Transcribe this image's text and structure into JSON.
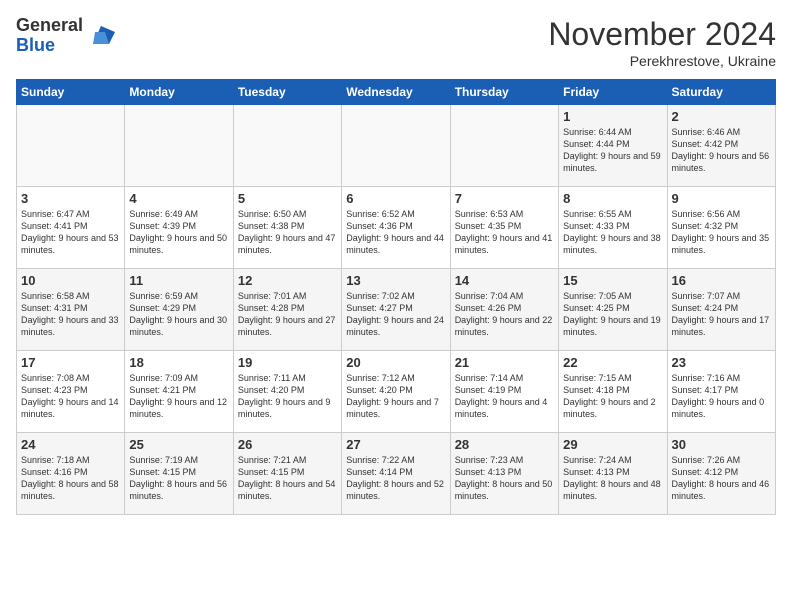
{
  "logo": {
    "general": "General",
    "blue": "Blue"
  },
  "header": {
    "month": "November 2024",
    "location": "Perekhrestove, Ukraine"
  },
  "days_of_week": [
    "Sunday",
    "Monday",
    "Tuesday",
    "Wednesday",
    "Thursday",
    "Friday",
    "Saturday"
  ],
  "weeks": [
    [
      {
        "day": "",
        "info": ""
      },
      {
        "day": "",
        "info": ""
      },
      {
        "day": "",
        "info": ""
      },
      {
        "day": "",
        "info": ""
      },
      {
        "day": "",
        "info": ""
      },
      {
        "day": "1",
        "info": "Sunrise: 6:44 AM\nSunset: 4:44 PM\nDaylight: 9 hours and 59 minutes."
      },
      {
        "day": "2",
        "info": "Sunrise: 6:46 AM\nSunset: 4:42 PM\nDaylight: 9 hours and 56 minutes."
      }
    ],
    [
      {
        "day": "3",
        "info": "Sunrise: 6:47 AM\nSunset: 4:41 PM\nDaylight: 9 hours and 53 minutes."
      },
      {
        "day": "4",
        "info": "Sunrise: 6:49 AM\nSunset: 4:39 PM\nDaylight: 9 hours and 50 minutes."
      },
      {
        "day": "5",
        "info": "Sunrise: 6:50 AM\nSunset: 4:38 PM\nDaylight: 9 hours and 47 minutes."
      },
      {
        "day": "6",
        "info": "Sunrise: 6:52 AM\nSunset: 4:36 PM\nDaylight: 9 hours and 44 minutes."
      },
      {
        "day": "7",
        "info": "Sunrise: 6:53 AM\nSunset: 4:35 PM\nDaylight: 9 hours and 41 minutes."
      },
      {
        "day": "8",
        "info": "Sunrise: 6:55 AM\nSunset: 4:33 PM\nDaylight: 9 hours and 38 minutes."
      },
      {
        "day": "9",
        "info": "Sunrise: 6:56 AM\nSunset: 4:32 PM\nDaylight: 9 hours and 35 minutes."
      }
    ],
    [
      {
        "day": "10",
        "info": "Sunrise: 6:58 AM\nSunset: 4:31 PM\nDaylight: 9 hours and 33 minutes."
      },
      {
        "day": "11",
        "info": "Sunrise: 6:59 AM\nSunset: 4:29 PM\nDaylight: 9 hours and 30 minutes."
      },
      {
        "day": "12",
        "info": "Sunrise: 7:01 AM\nSunset: 4:28 PM\nDaylight: 9 hours and 27 minutes."
      },
      {
        "day": "13",
        "info": "Sunrise: 7:02 AM\nSunset: 4:27 PM\nDaylight: 9 hours and 24 minutes."
      },
      {
        "day": "14",
        "info": "Sunrise: 7:04 AM\nSunset: 4:26 PM\nDaylight: 9 hours and 22 minutes."
      },
      {
        "day": "15",
        "info": "Sunrise: 7:05 AM\nSunset: 4:25 PM\nDaylight: 9 hours and 19 minutes."
      },
      {
        "day": "16",
        "info": "Sunrise: 7:07 AM\nSunset: 4:24 PM\nDaylight: 9 hours and 17 minutes."
      }
    ],
    [
      {
        "day": "17",
        "info": "Sunrise: 7:08 AM\nSunset: 4:23 PM\nDaylight: 9 hours and 14 minutes."
      },
      {
        "day": "18",
        "info": "Sunrise: 7:09 AM\nSunset: 4:21 PM\nDaylight: 9 hours and 12 minutes."
      },
      {
        "day": "19",
        "info": "Sunrise: 7:11 AM\nSunset: 4:20 PM\nDaylight: 9 hours and 9 minutes."
      },
      {
        "day": "20",
        "info": "Sunrise: 7:12 AM\nSunset: 4:20 PM\nDaylight: 9 hours and 7 minutes."
      },
      {
        "day": "21",
        "info": "Sunrise: 7:14 AM\nSunset: 4:19 PM\nDaylight: 9 hours and 4 minutes."
      },
      {
        "day": "22",
        "info": "Sunrise: 7:15 AM\nSunset: 4:18 PM\nDaylight: 9 hours and 2 minutes."
      },
      {
        "day": "23",
        "info": "Sunrise: 7:16 AM\nSunset: 4:17 PM\nDaylight: 9 hours and 0 minutes."
      }
    ],
    [
      {
        "day": "24",
        "info": "Sunrise: 7:18 AM\nSunset: 4:16 PM\nDaylight: 8 hours and 58 minutes."
      },
      {
        "day": "25",
        "info": "Sunrise: 7:19 AM\nSunset: 4:15 PM\nDaylight: 8 hours and 56 minutes."
      },
      {
        "day": "26",
        "info": "Sunrise: 7:21 AM\nSunset: 4:15 PM\nDaylight: 8 hours and 54 minutes."
      },
      {
        "day": "27",
        "info": "Sunrise: 7:22 AM\nSunset: 4:14 PM\nDaylight: 8 hours and 52 minutes."
      },
      {
        "day": "28",
        "info": "Sunrise: 7:23 AM\nSunset: 4:13 PM\nDaylight: 8 hours and 50 minutes."
      },
      {
        "day": "29",
        "info": "Sunrise: 7:24 AM\nSunset: 4:13 PM\nDaylight: 8 hours and 48 minutes."
      },
      {
        "day": "30",
        "info": "Sunrise: 7:26 AM\nSunset: 4:12 PM\nDaylight: 8 hours and 46 minutes."
      }
    ]
  ]
}
